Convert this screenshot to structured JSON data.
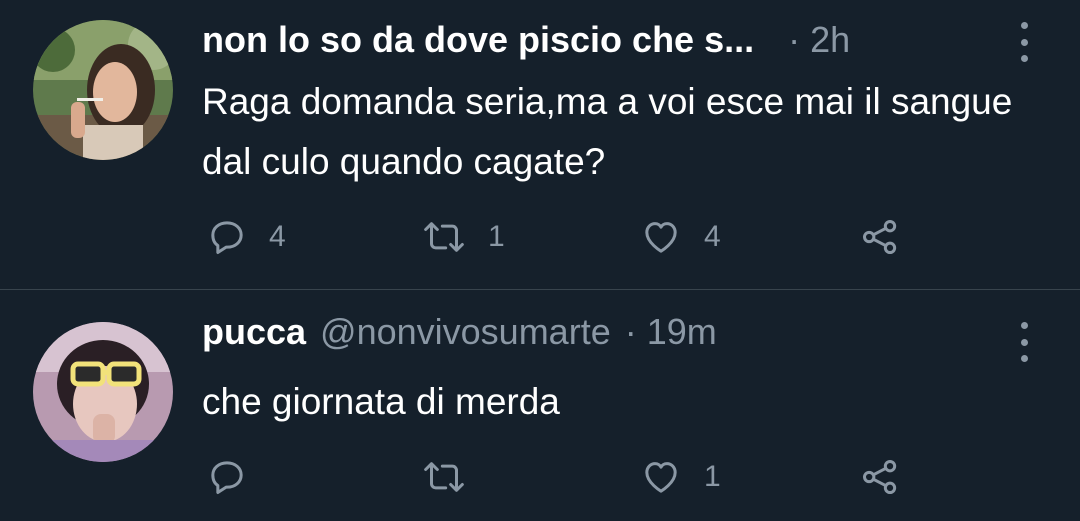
{
  "tweets": [
    {
      "display_name": "non lo so da dove piscio che s...",
      "handle": "",
      "dot": "·",
      "timestamp": "2h",
      "text": "Raga domanda seria,ma a voi esce mai il sangue dal culo quando cagate?",
      "reply_count": "4",
      "retweet_count": "1",
      "like_count": "4",
      "avatar_icon": "avatar-photo"
    },
    {
      "display_name": "pucca",
      "handle": "@nonvivosumarte",
      "dot": "·",
      "timestamp": "19m",
      "text": "che giornata di merda",
      "reply_count": "",
      "retweet_count": "",
      "like_count": "1",
      "avatar_icon": "avatar-photo"
    }
  ],
  "icons": {
    "reply": "reply-icon",
    "retweet": "retweet-icon",
    "like": "heart-icon",
    "share": "share-icon",
    "more": "more-vertical-icon"
  },
  "colors": {
    "background": "#15202b",
    "divider": "#38444d",
    "secondary_text": "#8b98a5",
    "primary_text": "#ffffff"
  }
}
